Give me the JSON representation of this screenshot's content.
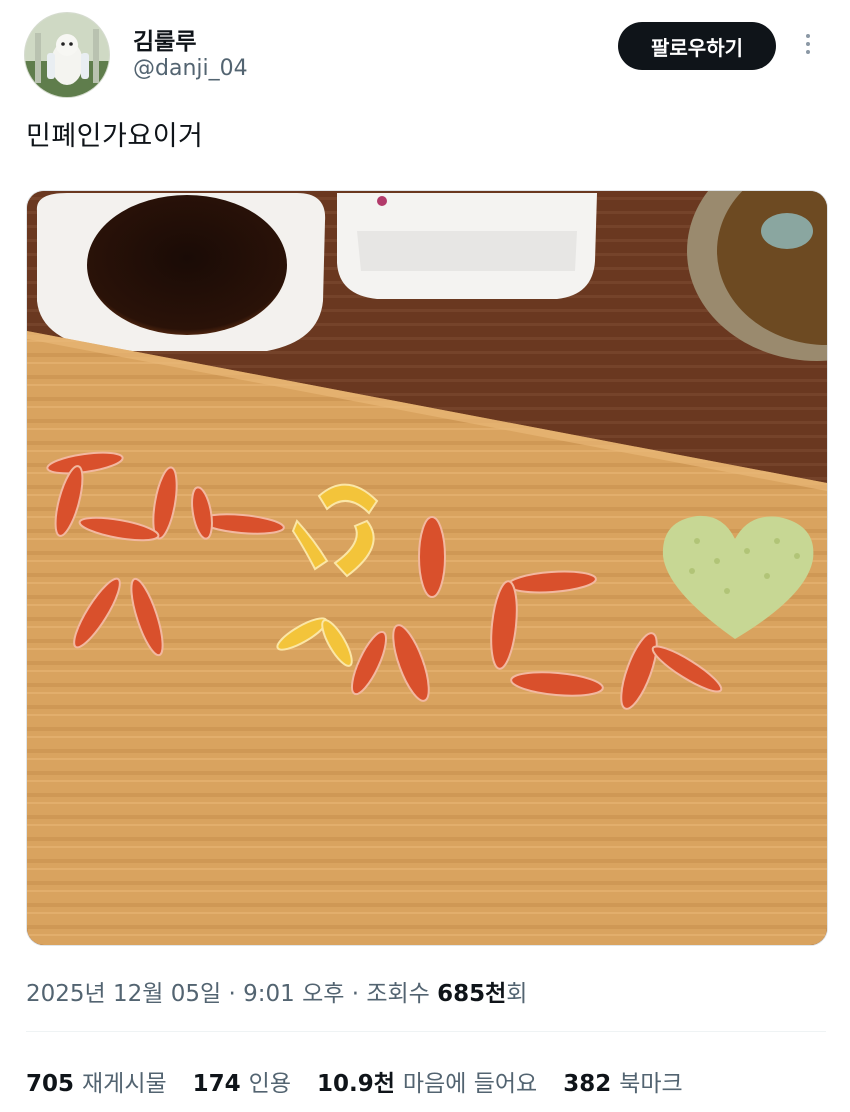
{
  "user": {
    "display_name": "김룰루",
    "handle": "@danji_04",
    "follow_label": "팔로우하기"
  },
  "tweet": {
    "text": "민폐인가요이거",
    "date": "2025년 12월 05일",
    "time": "9:01 오후",
    "views_label": "조회수",
    "views_count": "685천",
    "views_suffix": "회"
  },
  "stats": [
    {
      "count": "705",
      "label": "재게시물"
    },
    {
      "count": "174",
      "label": "인용"
    },
    {
      "count": "10.9천",
      "label": "마음에 들어요"
    },
    {
      "count": "382",
      "label": "북마크"
    }
  ],
  "icons": {
    "more": "more-options-icon",
    "avatar": "avatar-image"
  },
  "colors": {
    "follow_bg": "#0f1419",
    "secondary_text": "#536471"
  }
}
